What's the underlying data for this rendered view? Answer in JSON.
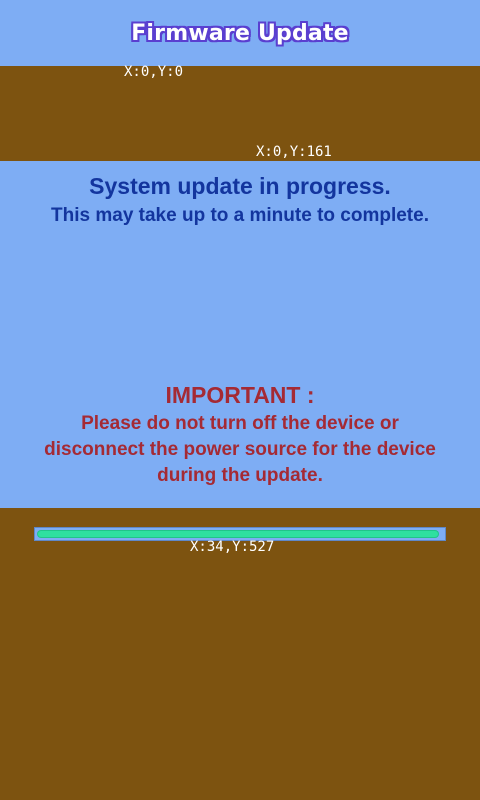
{
  "header": {
    "title": "Firmware Update"
  },
  "coordinates": {
    "top_panel_start": "X:0,Y:0",
    "top_panel_end": "X:0,Y:161",
    "progress_bar": "X:34,Y:527"
  },
  "status": {
    "title": "System update in progress.",
    "subtitle": "This may take up to a minute to complete."
  },
  "important": {
    "title": "IMPORTANT :",
    "lines": [
      "Please do not turn off the device or",
      "disconnect the power source for the device",
      "during the update."
    ]
  },
  "progress": {
    "percent": 99
  },
  "colors": {
    "background": "#7d5310",
    "panel": "#7eadf4",
    "status_text": "#13359e",
    "warning_text": "#a52a34",
    "progress_fill": "#2fe0a0"
  }
}
